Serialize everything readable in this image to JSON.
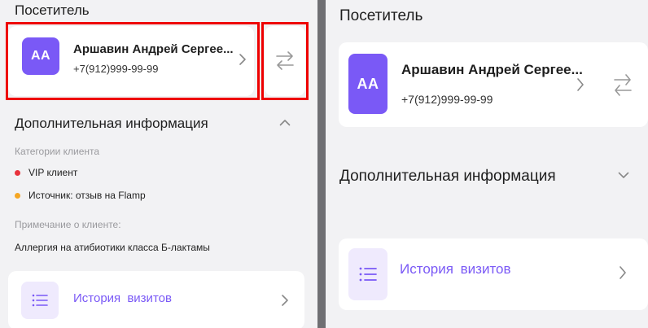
{
  "visitor_section": {
    "title": "Посетитель"
  },
  "client": {
    "initials": "АА",
    "name": "Аршавин Андрей Сергее...",
    "phone": "+7(912)999-99-99"
  },
  "additional_info": {
    "title": "Дополнительная информация",
    "categories_label": "Категории клиента",
    "categories": [
      {
        "label": "VIP клиент",
        "color": "#e8323c"
      },
      {
        "label": "Источник: отзыв на Flamp",
        "color": "#f5a623"
      }
    ],
    "note_label": "Примечание о клиенте:",
    "note_text": "Аллергия на атибиотики класса Б-лактамы"
  },
  "history": {
    "label": "История визитов"
  },
  "colors": {
    "accent": "#7a59f6",
    "highlight": "#ee0000"
  }
}
